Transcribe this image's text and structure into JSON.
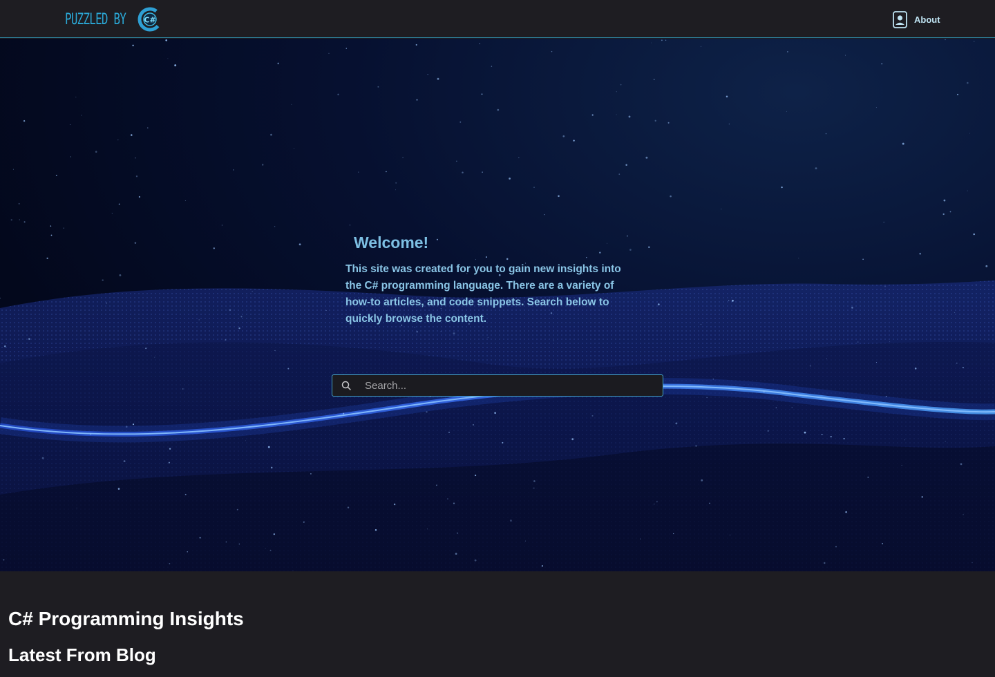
{
  "header": {
    "logo_text": "PUZZLED BY",
    "logo_mark": "C#",
    "about_label": "About",
    "about_icon": "user-profile-icon"
  },
  "hero": {
    "title": "Welcome!",
    "description": "This site was created for you to gain new insights into the C# programming language. There are a variety of how-to articles, and code snippets. Search below to quickly browse the content.",
    "search_placeholder": "Search...",
    "search_icon": "search-icon"
  },
  "sections": {
    "insights_title": "C# Programming Insights",
    "blog_title": "Latest From Blog"
  },
  "colors": {
    "page_bg": "#1e1d22",
    "accent": "#2ba9d8",
    "hero_text": "#8ac5e6",
    "header_border": "#2f8aa6"
  }
}
